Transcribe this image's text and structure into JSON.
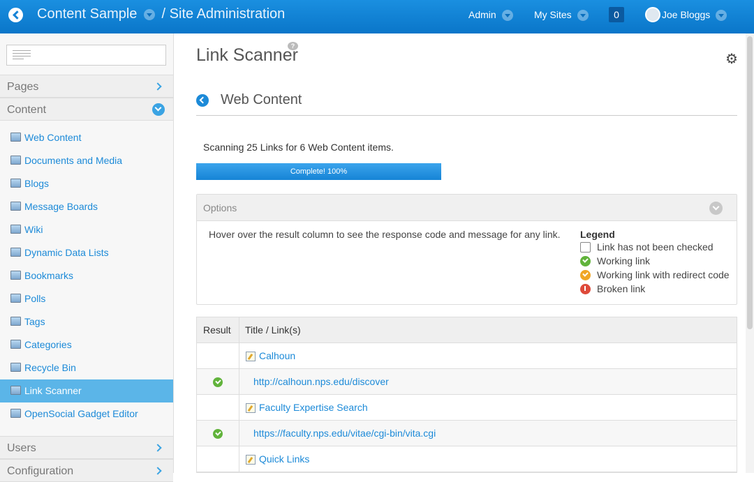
{
  "topbar": {
    "site_name": "Content Sample",
    "separator": "/",
    "section": "Site Administration",
    "admin_label": "Admin",
    "mysites_label": "My Sites",
    "notification_count": "0",
    "user_name": "Joe Bloggs"
  },
  "sidebar": {
    "pages_label": "Pages",
    "content_label": "Content",
    "items": [
      {
        "label": "Web Content",
        "icon": "web-content-icon"
      },
      {
        "label": "Documents and Media",
        "icon": "documents-icon"
      },
      {
        "label": "Blogs",
        "icon": "blogs-icon"
      },
      {
        "label": "Message Boards",
        "icon": "message-boards-icon"
      },
      {
        "label": "Wiki",
        "icon": "wiki-icon"
      },
      {
        "label": "Dynamic Data Lists",
        "icon": "ddl-icon"
      },
      {
        "label": "Bookmarks",
        "icon": "bookmarks-icon"
      },
      {
        "label": "Polls",
        "icon": "polls-icon"
      },
      {
        "label": "Tags",
        "icon": "tags-icon"
      },
      {
        "label": "Categories",
        "icon": "categories-icon"
      },
      {
        "label": "Recycle Bin",
        "icon": "recycle-bin-icon"
      },
      {
        "label": "Link Scanner",
        "icon": "link-icon"
      },
      {
        "label": "OpenSocial Gadget Editor",
        "icon": "gadget-icon"
      }
    ],
    "active_item": "Link Scanner",
    "users_label": "Users",
    "configuration_label": "Configuration"
  },
  "main": {
    "page_title": "Link Scanner",
    "help_glyph": "?",
    "section_title": "Web Content",
    "scan_summary": "Scanning 25 Links for 6 Web Content items.",
    "progress_label": "Complete! 100%",
    "progress_fraction": 1.0,
    "options_label": "Options",
    "hover_hint": "Hover over the result column to see the response code and message for any link.",
    "legend": {
      "title": "Legend",
      "items": [
        {
          "label": "Link has not been checked",
          "status": "unchecked"
        },
        {
          "label": "Working link",
          "status": "working"
        },
        {
          "label": "Working link with redirect code",
          "status": "redirect"
        },
        {
          "label": "Broken link",
          "status": "broken"
        }
      ]
    },
    "table": {
      "headers": [
        "Result",
        "Title / Link(s)"
      ],
      "rows": [
        {
          "type": "title",
          "text": "Calhoun",
          "status": ""
        },
        {
          "type": "link",
          "text": "http://calhoun.nps.edu/discover",
          "status": "working"
        },
        {
          "type": "title",
          "text": "Faculty Expertise Search",
          "status": ""
        },
        {
          "type": "link",
          "text": "https://faculty.nps.edu/vitae/cgi-bin/vita.cgi",
          "status": "working"
        },
        {
          "type": "title",
          "text": "Quick Links",
          "status": ""
        }
      ]
    }
  },
  "colors": {
    "topbar": "#0a76c9",
    "link": "#1c8ad8",
    "active_item": "#5bb5e8",
    "working": "#61b33b",
    "redirect": "#f0a626",
    "broken": "#de4a3a"
  }
}
